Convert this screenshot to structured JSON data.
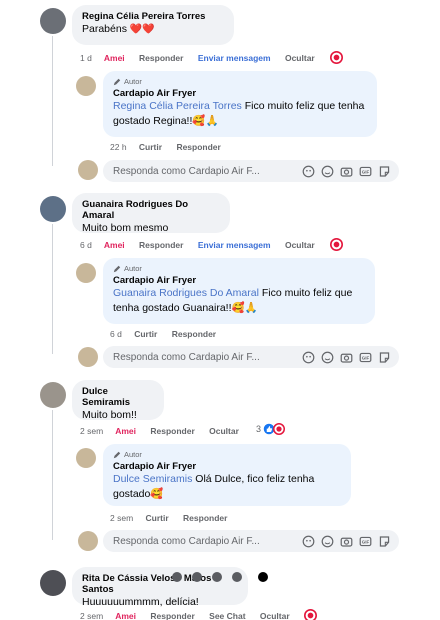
{
  "comments": [
    {
      "author": "Regina Célia Pereira Torres",
      "text": "Parabéns",
      "emoji": "❤️❤️",
      "time": "1 d",
      "actions": [
        "Amei",
        "Responder",
        "Enviar mensagem",
        "Ocultar"
      ],
      "reply": {
        "badge": "Autor",
        "page": "Cardapio Air Fryer",
        "mention": "Regina Célia Pereira Torres",
        "text": " Fico muito feliz que tenha gostado Regina!!🥰🙏",
        "time": "22 h",
        "actions": [
          "Curtir",
          "Responder"
        ]
      }
    },
    {
      "author": "Guanaira Rodrigues Do Amaral",
      "text": "Muito bom mesmo",
      "time": "6 d",
      "actions": [
        "Amei",
        "Responder",
        "Enviar mensagem",
        "Ocultar"
      ],
      "reply": {
        "badge": "Autor",
        "page": "Cardapio Air Fryer",
        "mention": "Guanaira Rodrigues Do Amaral",
        "text": " Fico muito feliz que tenha gostado Guanaira!!🥰🙏",
        "time": "6 d",
        "actions": [
          "Curtir",
          "Responder"
        ]
      }
    },
    {
      "author": "Dulce Semiramis",
      "text": "Muito bom!!",
      "time": "2 sem",
      "actions": [
        "Amei",
        "Responder",
        "Ocultar"
      ],
      "reaction_count": "3",
      "reply": {
        "badge": "Autor",
        "page": "Cardapio Air Fryer",
        "mention": "Dulce Semiramis",
        "text": " Olá Dulce, fico feliz tenha gostado🥰",
        "time": "2 sem",
        "actions": [
          "Curtir",
          "Responder"
        ]
      }
    },
    {
      "author": "Rita De Cássia Veloso Matos Santos",
      "text": "Huuuuuummmm, delícia!",
      "time": "2 sem",
      "actions": [
        "Amei",
        "Responder",
        "See Chat",
        "Ocultar"
      ]
    }
  ],
  "reply_placeholder": "Responda como Cardapio Air F...",
  "colors": {
    "bubble": "#f0f2f5",
    "author_bubble": "#ebf3fd",
    "link": "#4a74c7",
    "love": "#e0245e",
    "heart": "#e4173d"
  }
}
